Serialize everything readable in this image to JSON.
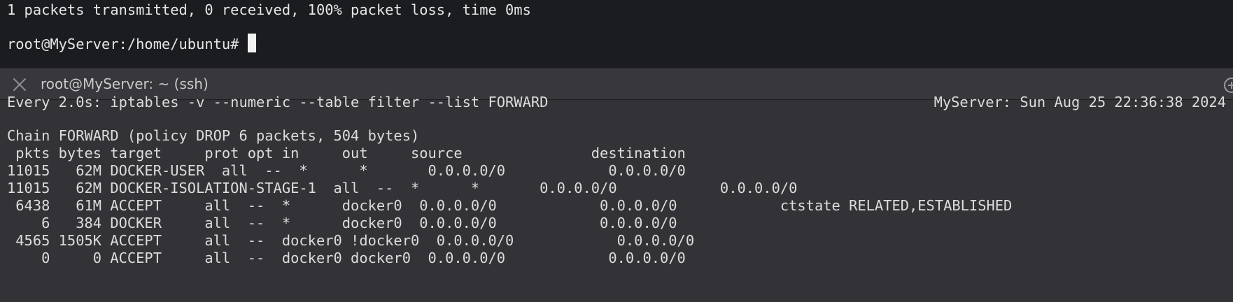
{
  "top_terminal": {
    "lines": [
      "1 packets transmitted, 0 received, 100% packet loss, time 0ms",
      "",
      "root@MyServer:/home/ubuntu# "
    ]
  },
  "tab": {
    "title": "root@MyServer: ~ (ssh)",
    "close_icon": "close-icon",
    "add_icon": "add-tab-icon"
  },
  "watch": {
    "header_left": "Every 2.0s: iptables -v --numeric --table filter --list FORWARD",
    "header_right": "MyServer: Sun Aug 25 22:36:38 2024"
  },
  "iptables": {
    "chain_line": "Chain FORWARD (policy DROP 6 packets, 504 bytes)",
    "header_line": " pkts bytes target     prot opt in     out     source               destination",
    "rows": [
      "11015   62M DOCKER-USER  all  --  *      *       0.0.0.0/0            0.0.0.0/0",
      "11015   62M DOCKER-ISOLATION-STAGE-1  all  --  *      *       0.0.0.0/0            0.0.0.0/0",
      " 6438   61M ACCEPT     all  --  *      docker0  0.0.0.0/0            0.0.0.0/0            ctstate RELATED,ESTABLISHED",
      "    6   384 DOCKER     all  --  *      docker0  0.0.0.0/0            0.0.0.0/0",
      " 4565 1505K ACCEPT     all  --  docker0 !docker0  0.0.0.0/0            0.0.0.0/0",
      "    0     0 ACCEPT     all  --  docker0 docker0  0.0.0.0/0            0.0.0.0/0"
    ]
  }
}
